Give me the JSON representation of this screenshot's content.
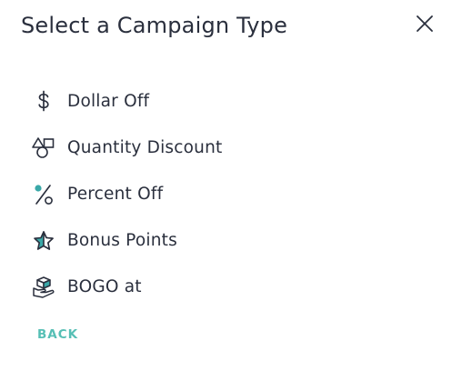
{
  "dialog": {
    "title": "Select a Campaign Type",
    "close_icon": "close-icon",
    "back_label": "BACK"
  },
  "campaign_types": [
    {
      "label": "Dollar Off",
      "icon": "dollar-sign-icon"
    },
    {
      "label": "Quantity Discount",
      "icon": "shapes-icon"
    },
    {
      "label": "Percent Off",
      "icon": "percent-icon"
    },
    {
      "label": "Bonus Points",
      "icon": "star-icon"
    },
    {
      "label": "BOGO at",
      "icon": "box-in-hand-icon"
    }
  ],
  "colors": {
    "text": "#2a2f3d",
    "accent": "#56bfb5",
    "icon_fill": "#3aa8a8"
  }
}
